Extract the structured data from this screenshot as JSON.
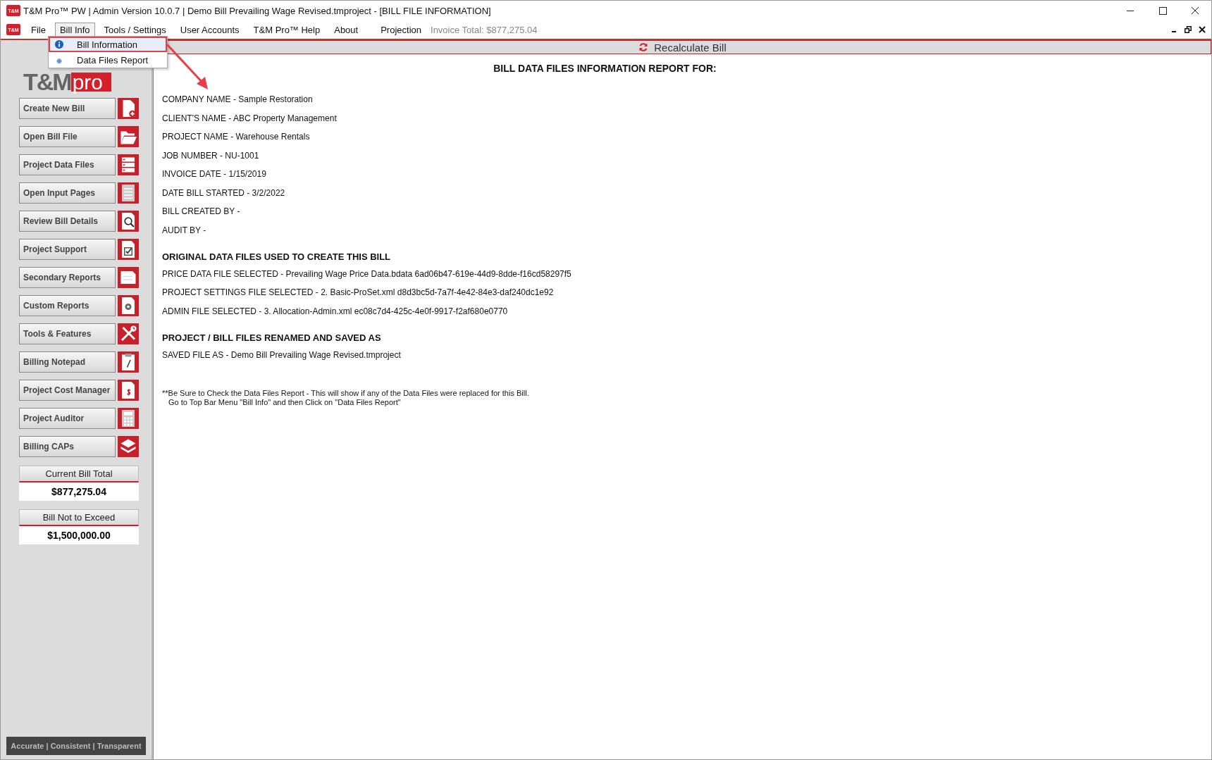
{
  "window": {
    "title": "T&M Pro™ PW | Admin Version 10.0.7 | Demo Bill Prevailing Wage Revised.tmproject - [BILL FILE INFORMATION]",
    "icon_text": "T&M"
  },
  "menu": {
    "icon_text": "T&M",
    "items": [
      {
        "label": "File",
        "selected": false
      },
      {
        "label": "Bill Info",
        "selected": true
      },
      {
        "label": "Tools / Settings",
        "selected": false
      },
      {
        "label": "User Accounts",
        "selected": false
      },
      {
        "label": "T&M Pro™ Help",
        "selected": false
      },
      {
        "label": "About",
        "selected": false
      },
      {
        "label": "Projection",
        "selected": false
      }
    ],
    "invoice_total": "Invoice Total: $877,275.04"
  },
  "dropdown": {
    "items": [
      {
        "label": "Bill Information",
        "highlighted": true
      },
      {
        "label": "Data Files Report",
        "highlighted": false
      }
    ]
  },
  "logo": {
    "text_1": "T&M",
    "text_2": "pro"
  },
  "sidebar": {
    "buttons": [
      "Create New Bill",
      "Open Bill File",
      "Project Data Files",
      "Open Input Pages",
      "Review Bill Details",
      "Project Support",
      "Secondary Reports",
      "Custom Reports",
      "Tools & Features",
      "Billing Notepad",
      "Project Cost Manager",
      "Project Auditor",
      "Billing CAPs"
    ],
    "totals": [
      {
        "label": "Current Bill Total",
        "value": "$877,275.04"
      },
      {
        "label": "Bill Not to Exceed",
        "value": "$1,500,000.00"
      }
    ],
    "tagline": "Accurate | Consistent | Transparent"
  },
  "recalculate": {
    "label": "Recalculate Bill"
  },
  "report": {
    "title": "BILL DATA FILES INFORMATION REPORT FOR:",
    "fields": [
      "COMPANY NAME - Sample Restoration",
      "CLIENT'S NAME - ABC Property Management",
      "PROJECT NAME - Warehouse Rentals",
      "JOB NUMBER - NU-1001",
      "INVOICE DATE - 1/15/2019",
      "DATE BILL STARTED - 3/2/2022",
      "BILL CREATED BY -",
      "AUDIT BY -"
    ],
    "sections": [
      {
        "heading": "ORIGINAL DATA FILES USED TO CREATE THIS BILL",
        "lines": [
          "PRICE DATA FILE SELECTED - Prevailing Wage Price Data.bdata 6ad06b47-619e-44d9-8dde-f16cd58297f5",
          "PROJECT SETTINGS FILE SELECTED - 2. Basic-ProSet.xml d8d3bc5d-7a7f-4e42-84e3-daf240dc1e92",
          "ADMIN FILE SELECTED - 3. Allocation-Admin.xml ec08c7d4-425c-4e0f-9917-f2af680e0770"
        ]
      },
      {
        "heading": "PROJECT / BILL FILES RENAMED AND SAVED AS",
        "lines": [
          "SAVED FILE AS - Demo Bill Prevailing Wage Revised.tmproject"
        ]
      }
    ],
    "note": [
      "**Be Sure to Check the Data Files Report - This will show if any of the Data Files were replaced for this Bill.",
      "Go to Top Bar Menu \"Bill Info\" and then Click on  \"Data Files Report\""
    ]
  }
}
